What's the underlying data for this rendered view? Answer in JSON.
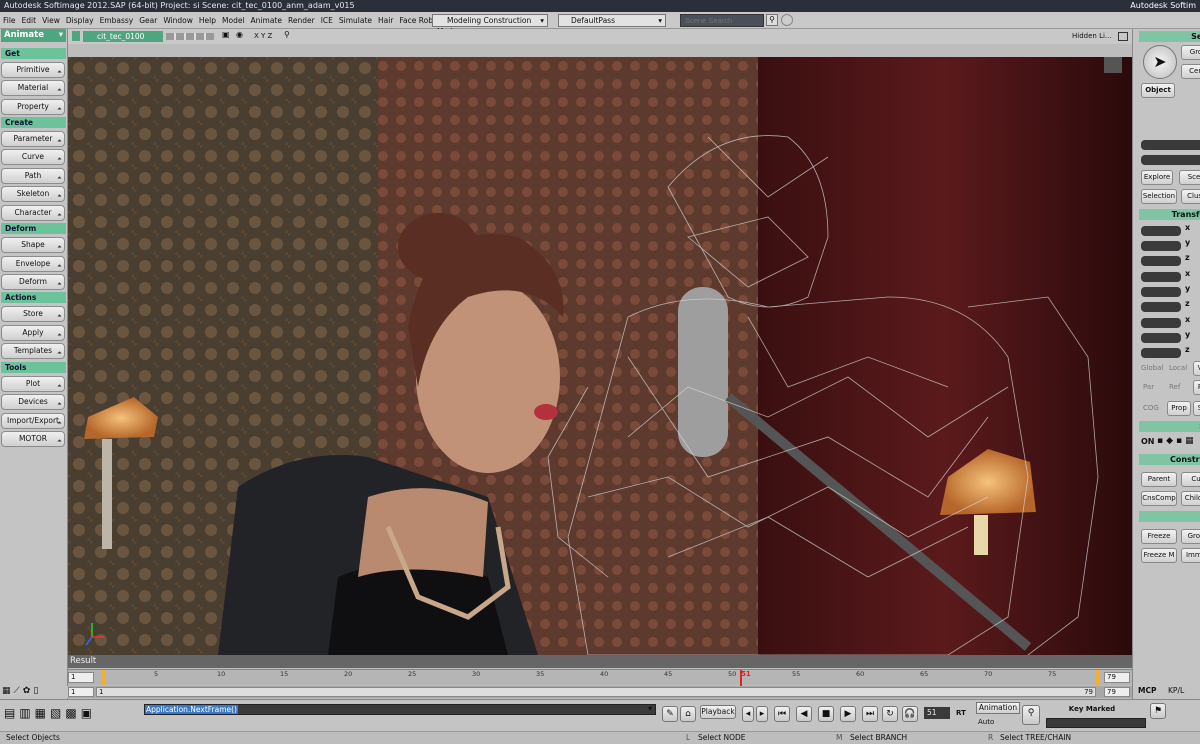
{
  "titlebar": {
    "text": "Autodesk Softimage 2012.SAP (64-bit)    Project: si    Scene: cit_tec_0100_anm_adam_v015",
    "brand": "Autodesk Softim"
  },
  "menu": [
    "File",
    "Edit",
    "View",
    "Display",
    "Embassy",
    "Gear",
    "Window",
    "Help",
    "Model",
    "Animate",
    "Render",
    "ICE",
    "Simulate",
    "Hair",
    "Face Robot"
  ],
  "construction_mode": "Modeling Construction Mode",
  "pass": "DefaultPass",
  "scene_search_placeholder": "Scene Search",
  "left": {
    "mode": "Animate",
    "sections": {
      "get": "Get",
      "create": "Create",
      "deform": "Deform",
      "actions": "Actions",
      "tools": "Tools"
    },
    "get_buttons": [
      "Primitive",
      "Material",
      "Property"
    ],
    "create_buttons": [
      "Parameter",
      "Curve",
      "Path",
      "Skeleton",
      "Character"
    ],
    "deform_buttons": [
      "Shape",
      "Envelope",
      "Deform"
    ],
    "actions_buttons": [
      "Store",
      "Apply",
      "Templates"
    ],
    "tools_buttons": [
      "Plot",
      "Devices",
      "Import/Export",
      "MOTOR"
    ]
  },
  "viewport": {
    "camera": "cit_tec_0100",
    "axes": "X Y Z",
    "display": "Hidden Li..."
  },
  "result_label": "Result",
  "right": {
    "sel": "Sel",
    "gro": "Gro",
    "cen": "Cen",
    "object": "Object",
    "explore": "Explore",
    "sce": "Sce",
    "selection": "Selection",
    "clust": "Clust",
    "transform": "Transfo",
    "axes": [
      "x",
      "y",
      "z",
      "x",
      "y",
      "z",
      "x",
      "y",
      "z"
    ],
    "global": "Global",
    "local": "Local",
    "v": "V",
    "par": "Par",
    "ref": "Ref",
    "p": "P",
    "cog": "COG",
    "prop": "Prop",
    "s": "S",
    "snap": "S",
    "on": "ON",
    "constrain": "Constra",
    "parent": "Parent",
    "cu": "Cu",
    "cnscomp": "CnsComp",
    "childc": "ChildC",
    "freeze": "Freeze",
    "grou": "Grou",
    "freeze_m": "Freeze M",
    "immed": "Imme"
  },
  "timeline": {
    "start": "1",
    "end": "79",
    "current": "51",
    "ticks": [
      "5",
      "10",
      "15",
      "20",
      "25",
      "30",
      "35",
      "40",
      "45",
      "50",
      "55",
      "60",
      "65",
      "70",
      "75"
    ],
    "range_start": "1",
    "range_in": "1",
    "range_out": "79",
    "range_end": "79"
  },
  "playback": {
    "command": "Application.NextFrame()",
    "playback_label": "Playback",
    "frame": "51",
    "rt": "RT",
    "animation": "Animation",
    "auto": "Auto",
    "key_marked": "Key Marked Parameters",
    "mcp": "MCP",
    "kpl": "KP/L"
  },
  "status": {
    "left": "Select Objects",
    "l": "L",
    "l_text": "Select NODE",
    "m": "M",
    "m_text": "Select BRANCH",
    "r": "R",
    "r_text": "Select TREE/CHAIN"
  }
}
